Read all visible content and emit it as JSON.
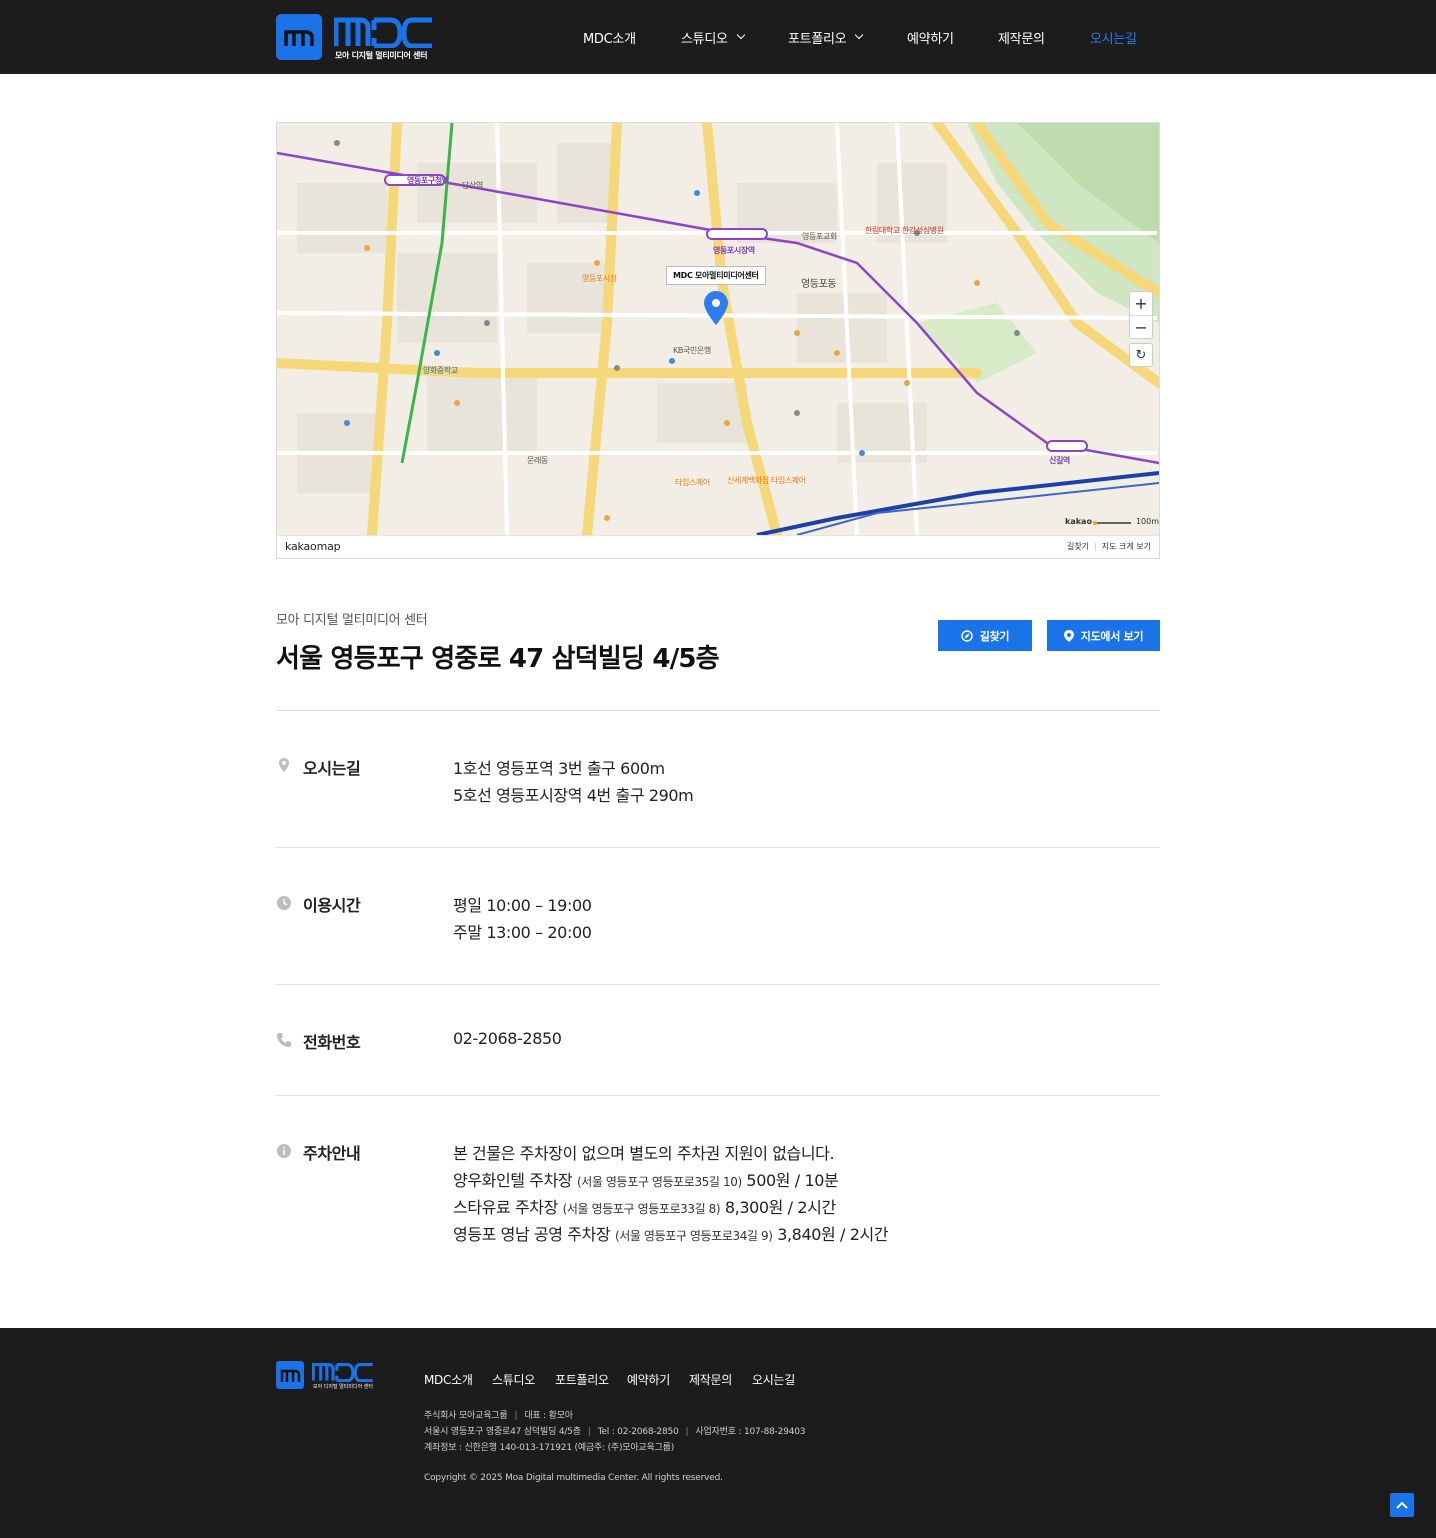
{
  "header": {
    "logo_sub": "모아 디지털 멀티미디어 센터",
    "nav": [
      {
        "label": "MDC소개",
        "dropdown": false
      },
      {
        "label": "스튜디오",
        "dropdown": true
      },
      {
        "label": "포트폴리오",
        "dropdown": true
      },
      {
        "label": "예약하기",
        "dropdown": false
      },
      {
        "label": "제작문의",
        "dropdown": false
      },
      {
        "label": "오시는길",
        "dropdown": false,
        "active": true
      }
    ],
    "accent_color": "#1a73e8"
  },
  "map": {
    "marker_label": "MDC 모아멀티미디어센터",
    "brand": "kakaomap",
    "links": [
      "길찾기",
      "지도 크게 보기"
    ],
    "scale_label": "100m",
    "scale_brand": "kakao",
    "zoom_in": "+",
    "zoom_out": "−",
    "places": [
      "영등포구청역",
      "당산역",
      "영등포시장역",
      "신길역",
      "영등포동",
      "영등포시장",
      "양화중학교",
      "KB국민은행",
      "영등포교회",
      "한림대학교 한강성심병원",
      "타임스퀘어",
      "신세계백화점 타임스퀘어",
      "문래동"
    ]
  },
  "location": {
    "subtitle": "모아 디지털 멀티미디어 센터",
    "address": "서울 영등포구 영중로 47 삼덕빌딩 4/5층",
    "btn_route": "길찾기",
    "btn_mapview": "지도에서 보기"
  },
  "info": {
    "directions": {
      "label": "오시는길",
      "lines": [
        "1호선 영등포역 3번 출구 600m",
        "5호선 영등포시장역 4번 출구 290m"
      ]
    },
    "hours": {
      "label": "이용시간",
      "lines": [
        "평일 10:00 – 19:00",
        "주말 13:00 – 20:00"
      ]
    },
    "phone": {
      "label": "전화번호",
      "value": "02-2068-2850"
    },
    "parking": {
      "label": "주차안내",
      "intro": "본 건물은 주차장이 없으며 별도의 주차권 지원이 없습니다.",
      "lots": [
        {
          "name": "양우화인텔 주차장",
          "addr": "(서울 영등포구 영등포로35길 10)",
          "price": "500원 / 10분"
        },
        {
          "name": "스타유료 주차장",
          "addr": "(서울 영등포구 영등포로33길 8)",
          "price": "8,300원 / 2시간"
        },
        {
          "name": "영등포 영남 공영 주차장",
          "addr": "(서울 영등포구 영등포로34길 9)",
          "price": "3,840원 / 2시간"
        }
      ]
    }
  },
  "footer": {
    "logo_sub": "모아 디지털 멀티미디어 센터",
    "nav": [
      "MDC소개",
      "스튜디오",
      "포트폴리오",
      "예약하기",
      "제작문의",
      "오시는길"
    ],
    "company_line": [
      "주식회사 모아교육그룹",
      "대표 : 황모아"
    ],
    "address_line": [
      "서울시 영등포구 영중로47 삼덕빌딩 4/5층",
      "Tel : 02-2068-2850",
      "사업자번호 : 107-88-29403"
    ],
    "account_line": "계좌정보 : 신한은행 140-013-171921 (예금주: (주)모아교육그룹)",
    "copyright": "Copyright © 2025 Moa Digital multimedia Center. All rights reserved."
  }
}
